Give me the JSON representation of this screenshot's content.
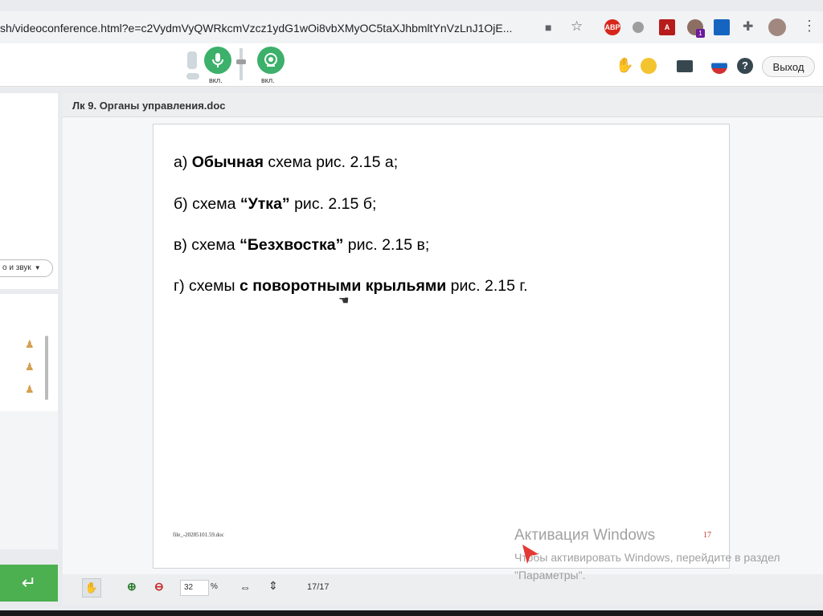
{
  "browser": {
    "url": "sh/videoconference.html?e=c2VydmVyQWRkcmVzcz1ydG1wOi8vbXMyOC5taXJhbmltYnVzLnJ1OjE...",
    "ext_abp": "ABP",
    "ext_badge": "1"
  },
  "toolbar": {
    "mic_label": "вкл.",
    "cam_label": "вкл.",
    "exit_label": "Выход"
  },
  "left_panel": {
    "av_select": "о и звук"
  },
  "document": {
    "title": "Лк 9. Органы управления.doc",
    "lines": [
      {
        "pre": "а) ",
        "bold": "Обычная",
        "post": " схема рис. 2.15 а;"
      },
      {
        "pre": "б) схема ",
        "bold": "“Утка”",
        "post": " рис. 2.15 б;"
      },
      {
        "pre": "в) схема ",
        "bold": "“Безхвостка”",
        "post": " рис. 2.15 в;"
      },
      {
        "pre": "г) схемы ",
        "bold": "с поворотными крыльями",
        "post": " рис. 2.15 г."
      }
    ],
    "footer_file": "file_-20285101.59.doc",
    "footer_page_number": "17"
  },
  "viewer": {
    "zoom_value": "32",
    "zoom_unit": "%",
    "page_indicator": "17/17"
  },
  "watermark": {
    "title": "Активация Windows",
    "text": "Чтобы активировать Windows, перейдите в раздел \"Параметры\"."
  },
  "colors": {
    "accent_green": "#3db06b",
    "enter_button": "#4caf50"
  }
}
